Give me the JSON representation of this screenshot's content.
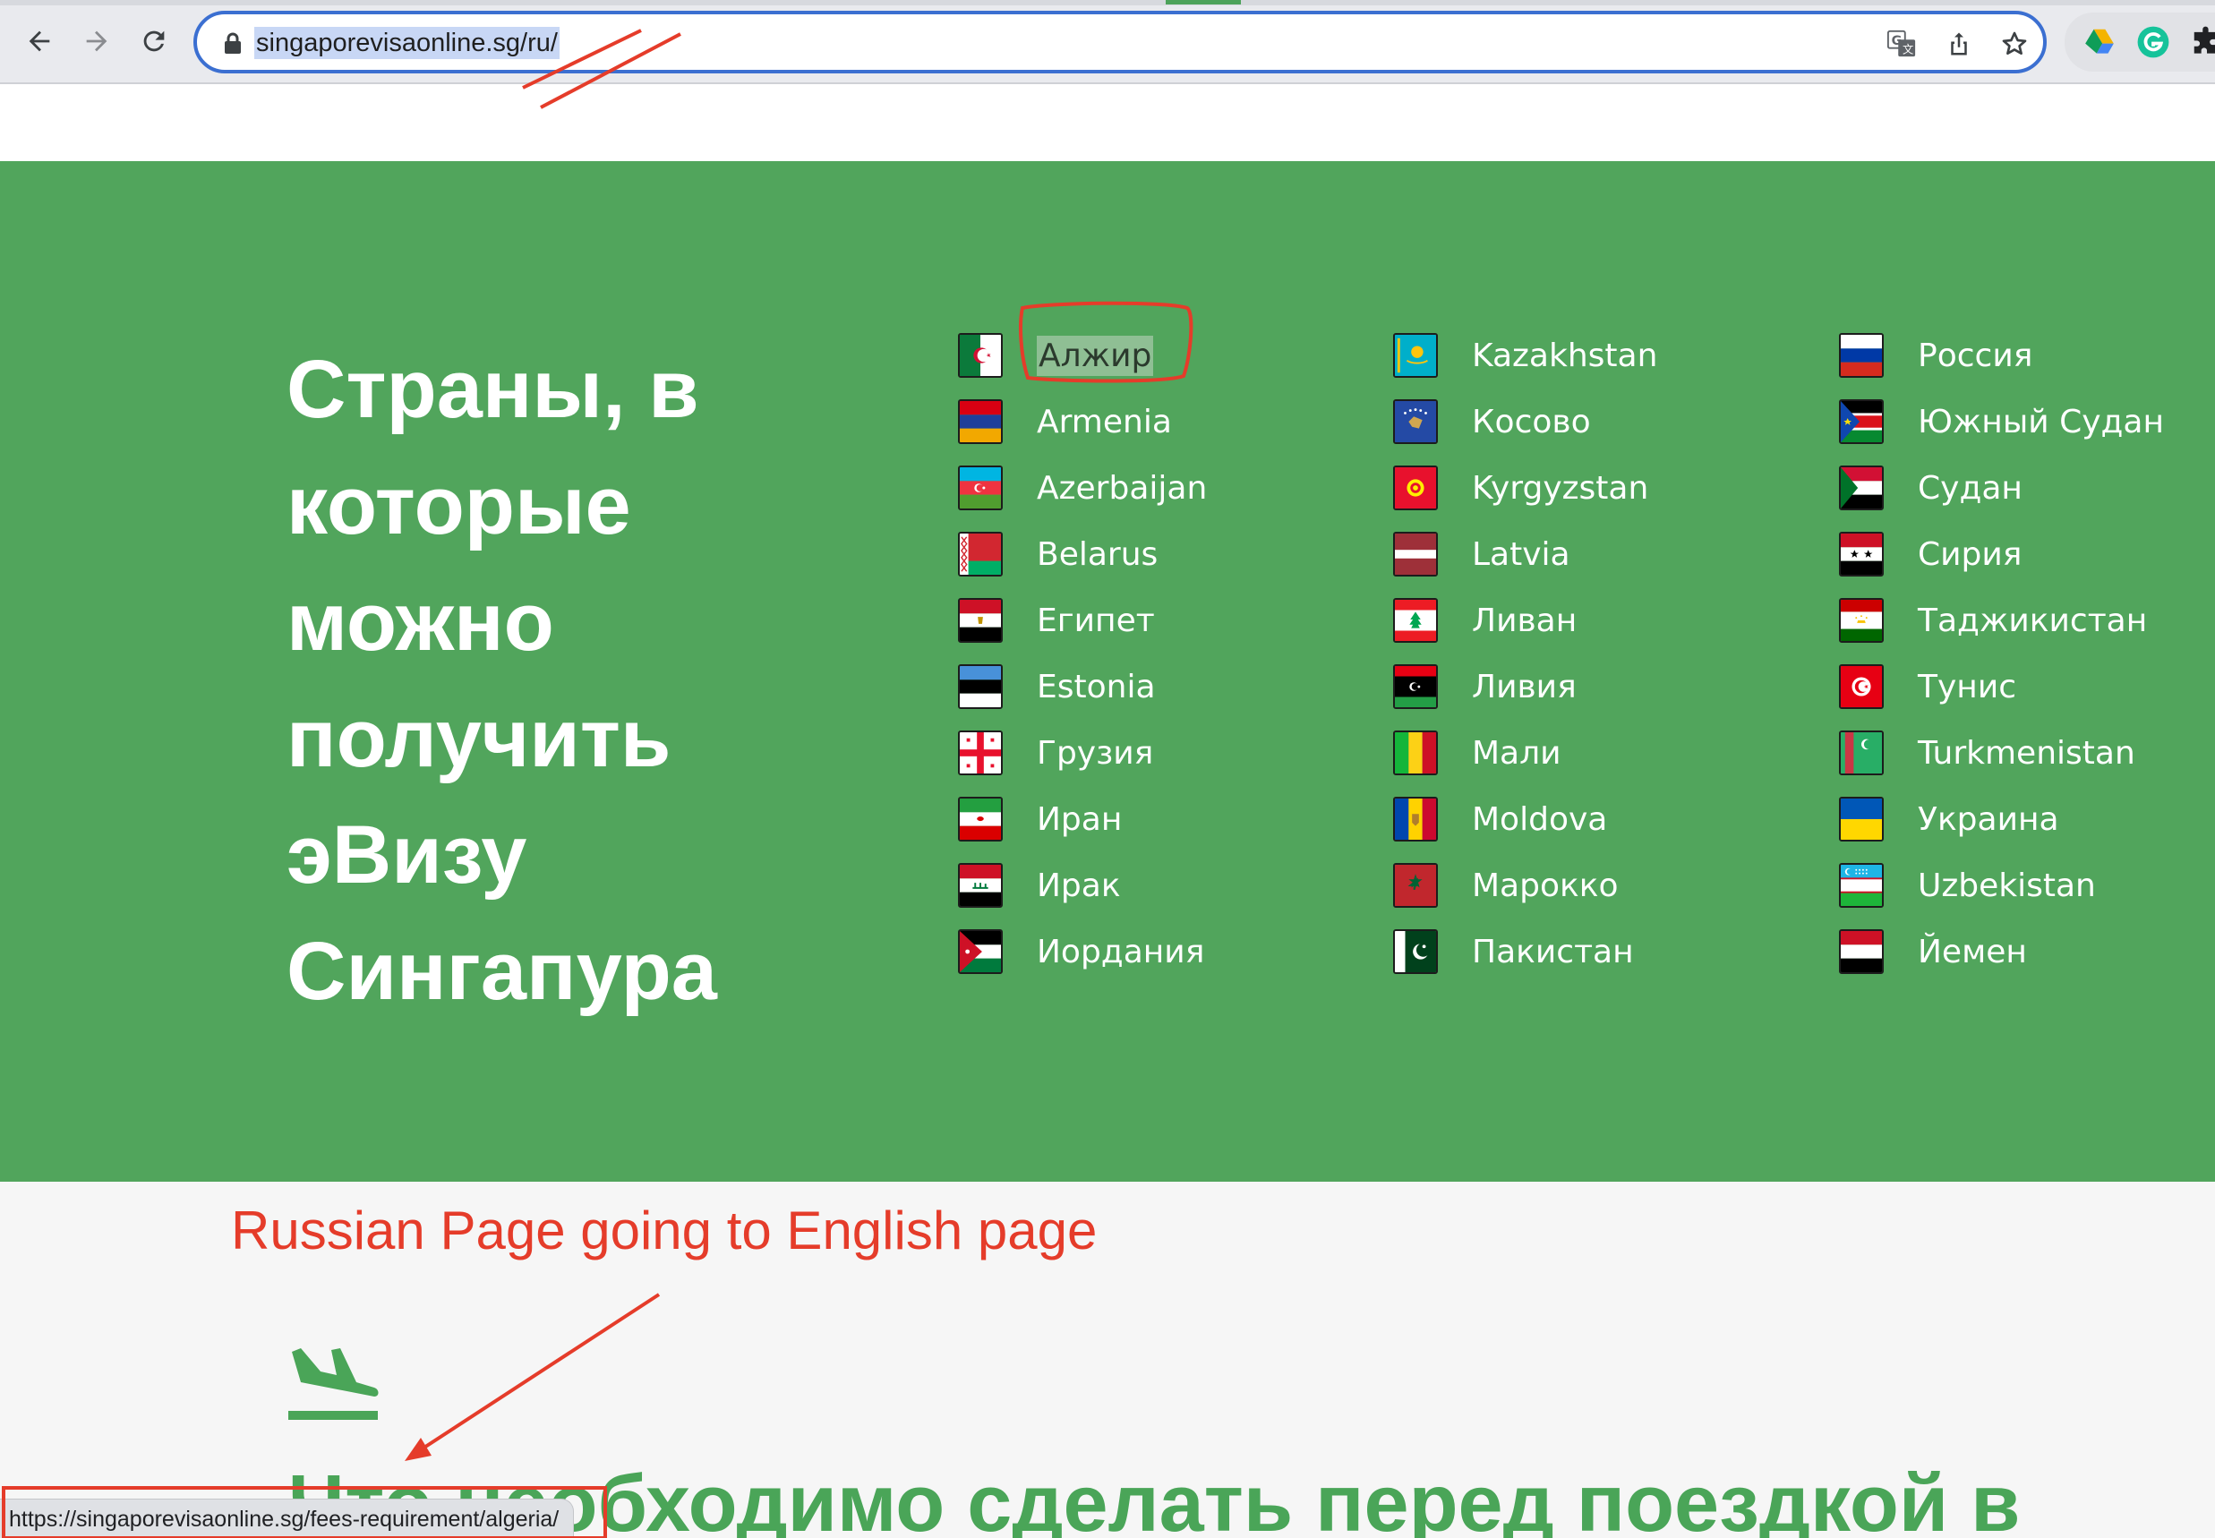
{
  "browser": {
    "url": "singaporevisaonline.sg/ru/",
    "status_url": "https://singaporevisaonline.sg/fees-requirement/algeria/"
  },
  "hero": {
    "heading_lines": [
      "Страны, в",
      "которые",
      "можно",
      "получить",
      "эВизу",
      "Сингапура"
    ]
  },
  "countries": {
    "col1": [
      {
        "name": "Алжир",
        "flag": "algeria-flag"
      },
      {
        "name": "Armenia",
        "flag": "armenia-flag"
      },
      {
        "name": "Azerbaijan",
        "flag": "azerbaijan-flag"
      },
      {
        "name": "Belarus",
        "flag": "belarus-flag"
      },
      {
        "name": "Египет",
        "flag": "egypt-flag"
      },
      {
        "name": "Estonia",
        "flag": "estonia-flag"
      },
      {
        "name": "Грузия",
        "flag": "georgia-flag"
      },
      {
        "name": "Иран",
        "flag": "iran-flag"
      },
      {
        "name": "Ирак",
        "flag": "iraq-flag"
      },
      {
        "name": "Иордания",
        "flag": "jordan-flag"
      }
    ],
    "col2": [
      {
        "name": "Kazakhstan",
        "flag": "kazakhstan-flag"
      },
      {
        "name": "Косово",
        "flag": "kosovo-flag"
      },
      {
        "name": "Kyrgyzstan",
        "flag": "kyrgyzstan-flag"
      },
      {
        "name": "Latvia",
        "flag": "latvia-flag"
      },
      {
        "name": "Ливан",
        "flag": "lebanon-flag"
      },
      {
        "name": "Ливия",
        "flag": "libya-flag"
      },
      {
        "name": "Мали",
        "flag": "mali-flag"
      },
      {
        "name": "Moldova",
        "flag": "moldova-flag"
      },
      {
        "name": "Марокко",
        "flag": "morocco-flag"
      },
      {
        "name": "Пакистан",
        "flag": "pakistan-flag"
      }
    ],
    "col3": [
      {
        "name": "Россия",
        "flag": "russia-flag"
      },
      {
        "name": "Южный Судан",
        "flag": "south-sudan-flag"
      },
      {
        "name": "Судан",
        "flag": "sudan-flag"
      },
      {
        "name": "Сирия",
        "flag": "syria-flag"
      },
      {
        "name": "Таджикистан",
        "flag": "tajikistan-flag"
      },
      {
        "name": "Тунис",
        "flag": "tunisia-flag"
      },
      {
        "name": "Turkmenistan",
        "flag": "turkmenistan-flag"
      },
      {
        "name": "Украина",
        "flag": "ukraine-flag"
      },
      {
        "name": "Uzbekistan",
        "flag": "uzbekistan-flag"
      },
      {
        "name": "Йемен",
        "flag": "yemen-flag"
      }
    ]
  },
  "annotation": {
    "text": "Russian Page going to English page"
  },
  "next_section": {
    "heading": "Что необходимо сделать перед поездкой в"
  },
  "colors": {
    "brand_green": "#51a55c",
    "annotation_red": "#e53c2a",
    "omnibox_focus": "#3b6fd1"
  }
}
